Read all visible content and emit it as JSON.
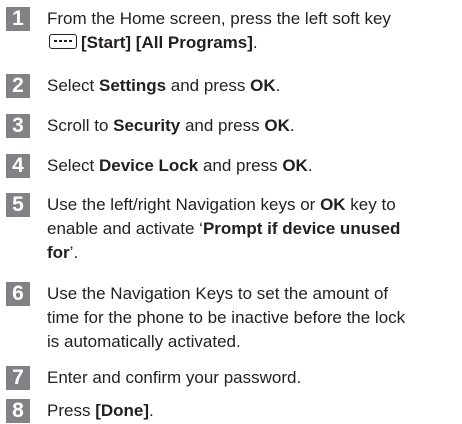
{
  "steps": [
    {
      "number": "1",
      "line1": "From the Home screen, press the left soft key",
      "line2_bold": "[Start] [All Programs]",
      "line2_end": "."
    },
    {
      "number": "2",
      "pre": "Select ",
      "b1": "Settings",
      "mid": " and press ",
      "b2": "OK",
      "end": "."
    },
    {
      "number": "3",
      "pre": "Scroll to ",
      "b1": "Security",
      "mid": " and press ",
      "b2": "OK",
      "end": "."
    },
    {
      "number": "4",
      "pre": "Select ",
      "b1": "Device Lock",
      "mid": " and press ",
      "b2": "OK",
      "end": "."
    },
    {
      "number": "5",
      "l1_pre": "Use the left/right Navigation keys or ",
      "l1_bold": "OK",
      "l1_end": " key to",
      "l2_pre": "enable and activate ‘",
      "l2_bold": "Prompt if device unused",
      "l3_bold": "for",
      "l3_end": "’."
    },
    {
      "number": "6",
      "line1": "Use the Navigation Keys to set the amount of",
      "line2": "time for the phone to be inactive before the lock",
      "line3": "is automatically activated."
    },
    {
      "number": "7",
      "text": "Enter and confirm your password."
    },
    {
      "number": "8",
      "pre": "Press ",
      "bold": "[Done]",
      "end": "."
    }
  ],
  "icons": {
    "soft_key": "left-soft-key-icon"
  }
}
